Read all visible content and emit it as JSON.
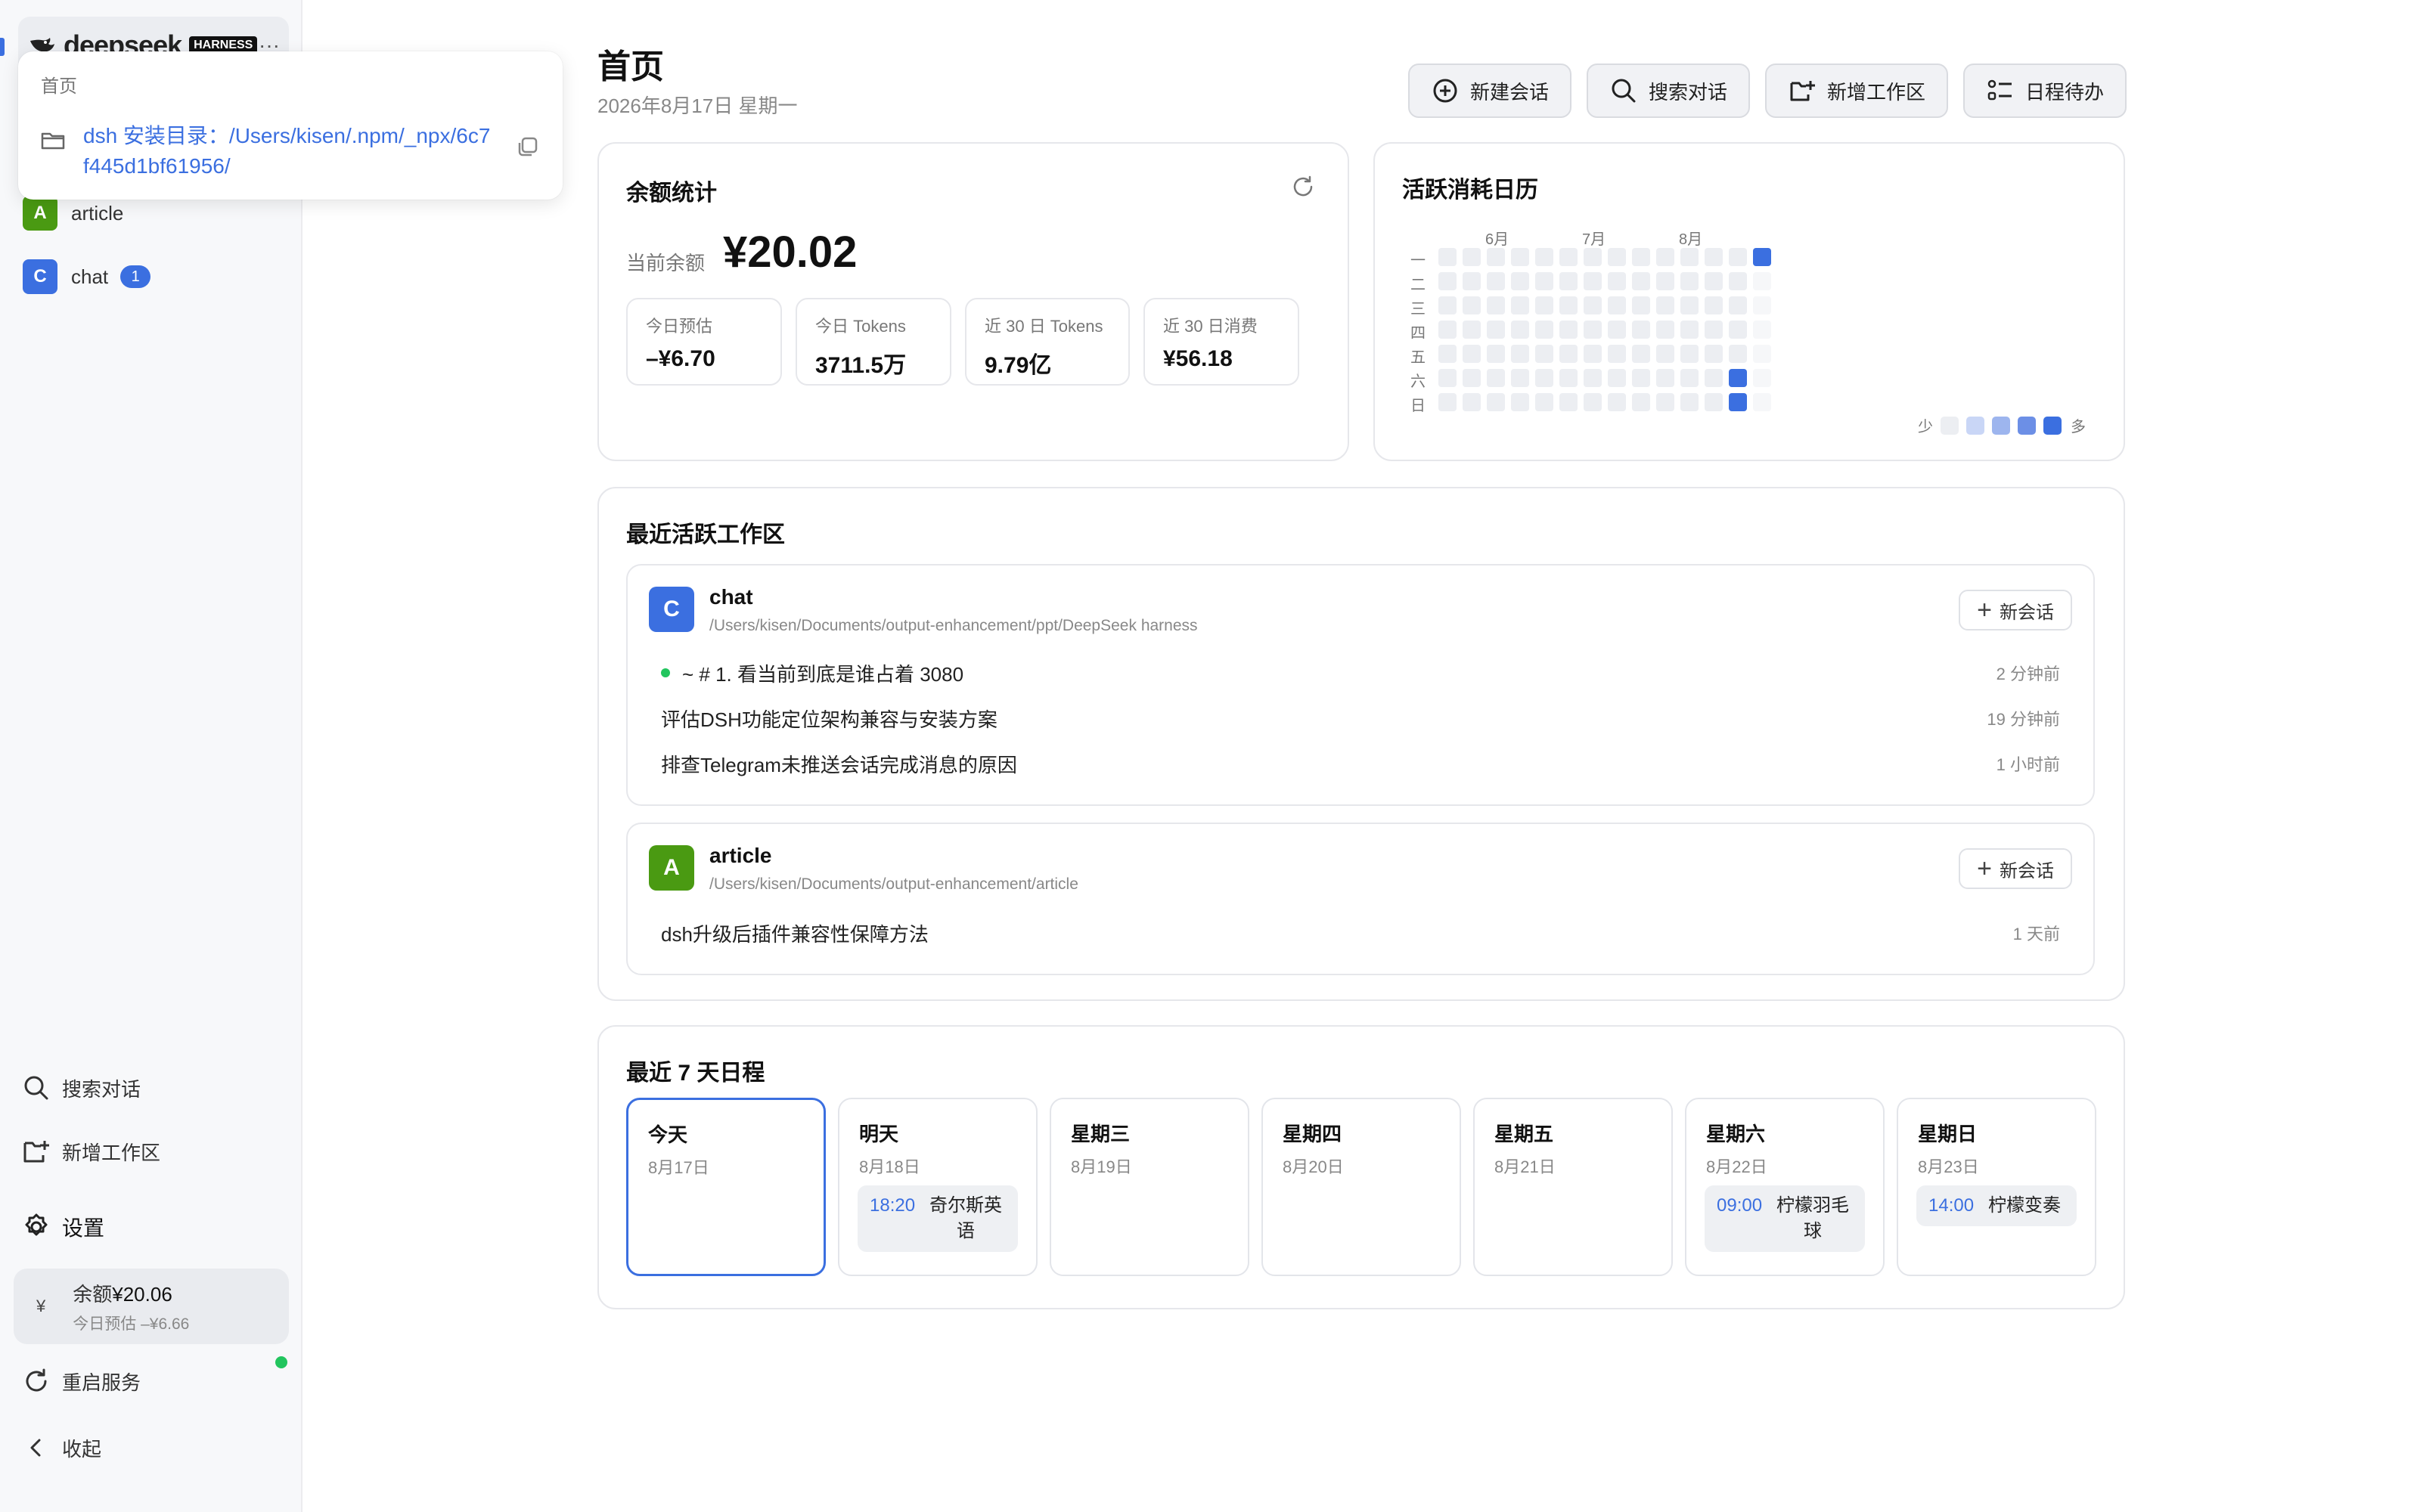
{
  "sidebar": {
    "brand": {
      "name": "deepseek",
      "badge": "HARNESS",
      "more": "···"
    },
    "workspaces": [
      {
        "initial": "A",
        "label": "article",
        "color": "#4a9a12"
      },
      {
        "initial": "C",
        "label": "chat",
        "color": "#3b6fe0",
        "badge": "1"
      }
    ],
    "search_label": "搜索对话",
    "add_workspace_label": "新增工作区",
    "settings_label": "设置",
    "balance": {
      "symbol": "¥",
      "label": "余额",
      "value": "¥20.06",
      "sub": "今日预估 –¥6.66"
    },
    "restart_label": "重启服务",
    "collapse_label": "收起"
  },
  "popover": {
    "title": "首页",
    "path": "dsh 安装目录：/Users/kisen/.npm/_npx/6c7f445d1bf61956/"
  },
  "header": {
    "title": "首页",
    "date": "2026年8月17日 星期一",
    "actions": [
      "新建会话",
      "搜索对话",
      "新增工作区",
      "日程待办"
    ]
  },
  "balance_card": {
    "title": "余额统计",
    "current_label": "当前余额",
    "current_value": "¥20.02",
    "stats": [
      {
        "label": "今日预估",
        "value": "–¥6.70"
      },
      {
        "label": "今日 Tokens",
        "value": "3711.5万"
      },
      {
        "label": "近 30 日 Tokens",
        "value": "9.79亿"
      },
      {
        "label": "近 30 日消费",
        "value": "¥56.18"
      }
    ]
  },
  "calendar_card": {
    "title": "活跃消耗日历",
    "months": [
      "6月",
      "7月",
      "8月"
    ],
    "weekdays": [
      "一",
      "二",
      "三",
      "四",
      "五",
      "六",
      "日"
    ],
    "legend_low": "少",
    "legend_high": "多",
    "legend_colors": [
      "#eceef2",
      "#c9d6f6",
      "#9db5ee",
      "#6c8fe6",
      "#3b6fe0"
    ],
    "active_cells": [
      {
        "week": 13,
        "day": 0,
        "level": 4
      },
      {
        "week": 12,
        "day": 5,
        "level": 4
      },
      {
        "week": 12,
        "day": 6,
        "level": 4
      }
    ]
  },
  "recent_workspaces": {
    "title": "最近活跃工作区",
    "new_chat_label": "新会话",
    "items": [
      {
        "initial": "C",
        "name": "chat",
        "color": "#3b6fe0",
        "path": "/Users/kisen/Documents/output-enhancement/ppt/DeepSeek harness",
        "conversations": [
          {
            "title": "~ # 1. 看当前到底是谁占着 3080",
            "time": "2 分钟前",
            "active": true
          },
          {
            "title": "评估DSH功能定位架构兼容与安装方案",
            "time": "19 分钟前"
          },
          {
            "title": "排查Telegram未推送会话完成消息的原因",
            "time": "1 小时前"
          }
        ]
      },
      {
        "initial": "A",
        "name": "article",
        "color": "#4a9a12",
        "path": "/Users/kisen/Documents/output-enhancement/article",
        "conversations": [
          {
            "title": "dsh升级后插件兼容性保障方法",
            "time": "1 天前"
          }
        ]
      }
    ]
  },
  "schedule": {
    "title": "最近 7 天日程",
    "days": [
      {
        "name": "今天",
        "date": "8月17日",
        "today": true
      },
      {
        "name": "明天",
        "date": "8月18日",
        "event": {
          "time": "18:20",
          "title": "奇尔斯英语"
        }
      },
      {
        "name": "星期三",
        "date": "8月19日"
      },
      {
        "name": "星期四",
        "date": "8月20日"
      },
      {
        "name": "星期五",
        "date": "8月21日"
      },
      {
        "name": "星期六",
        "date": "8月22日",
        "event": {
          "time": "09:00",
          "title": "柠檬羽毛球"
        }
      },
      {
        "name": "星期日",
        "date": "8月23日",
        "event": {
          "time": "14:00",
          "title": "柠檬变奏"
        }
      }
    ]
  }
}
